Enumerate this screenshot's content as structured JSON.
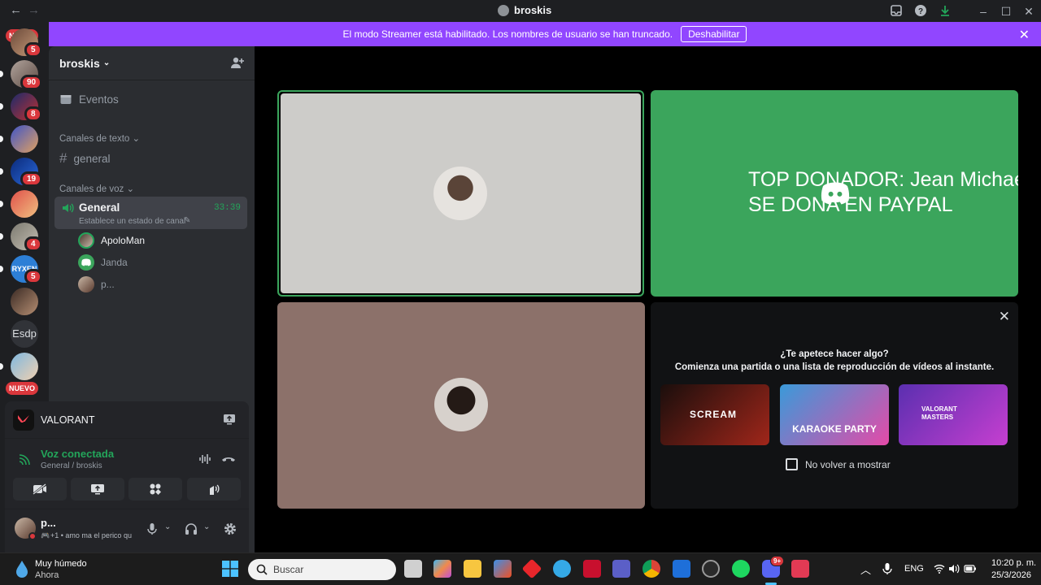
{
  "window": {
    "title": "broskis"
  },
  "rail": {
    "nuevo_label": "NUEVO",
    "badges": [
      "5",
      "90",
      "8",
      "19",
      "4",
      "5"
    ],
    "text_server": "Esdp",
    "ryxen_label": "RYXEN"
  },
  "banner": {
    "text": "El modo Streamer está habilitado. Los nombres de usuario se han truncado.",
    "button": "Deshabilitar"
  },
  "sidebar": {
    "server_name": "broskis",
    "events": "Eventos",
    "text_category": "Canales de texto",
    "text_channel": "general",
    "voice_category": "Canales de voz",
    "voice_channel": {
      "name": "General",
      "status": "Establece un estado de canal",
      "timer": "33:39"
    },
    "members": [
      "ApoloMan",
      "Janda",
      "p..."
    ]
  },
  "activity": {
    "name": "VALORANT"
  },
  "voice": {
    "status": "Voz conectada",
    "location": "General / broskis"
  },
  "user": {
    "name": "p...",
    "status": "+1 • amo ma el perico qu"
  },
  "stage": {
    "overlay_line1": "TOP DONADOR: Jean Michael",
    "overlay_line2": "SE DONA EN PAYPAL",
    "activity_prompt_title": "¿Te apetece hacer algo?",
    "activity_prompt_sub": "Comienza una partida o una lista de reproducción de vídeos al instante.",
    "dont_show": "No volver a mostrar",
    "cards": [
      {
        "title": "SCREAM",
        "colors": [
          "#1a0e0c",
          "#a0261a"
        ]
      },
      {
        "title": "KARAOKE PARTY",
        "colors": [
          "#3a9ad9",
          "#e54aa8"
        ]
      },
      {
        "title": "VALORANT MASTERS",
        "colors": [
          "#5b2fb0",
          "#c63fd0"
        ]
      }
    ],
    "tile_colors": {
      "top_left": "#cdccc9",
      "top_right": "#3ba55c",
      "bottom_left": "#8c716a",
      "accent": "#3ba55c"
    }
  },
  "taskbar": {
    "weather_title": "Muy húmedo",
    "weather_sub": "Ahora",
    "search_placeholder": "Buscar",
    "lang": "ENG",
    "time": "10:20 p. m.",
    "date": "25/3/2026",
    "discord_badge": "9+"
  }
}
